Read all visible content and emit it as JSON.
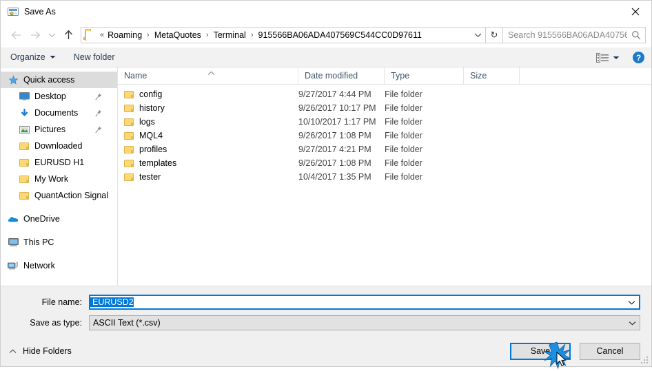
{
  "window": {
    "title": "Save As",
    "icon": "save-as-app-icon",
    "close_label": "✕"
  },
  "nav": {
    "back_icon": "back-arrow-icon",
    "forward_icon": "forward-arrow-icon",
    "recent_icon": "recent-locations-chevron-icon",
    "up_icon": "up-arrow-icon",
    "folder_icon": "folder-icon",
    "overflow": "«",
    "breadcrumbs": [
      "Roaming",
      "MetaQuotes",
      "Terminal",
      "915566BA06ADA407569C544CC0D97611"
    ],
    "separator": "›",
    "dropdown_icon": "chevron-down-icon",
    "refresh_icon": "refresh-icon",
    "refresh_glyph": "↻"
  },
  "search": {
    "placeholder": "Search 915566BA06ADA40756...",
    "icon": "search-icon"
  },
  "toolbar": {
    "organize_label": "Organize",
    "organize_caret": "chevron-down-icon",
    "new_folder_label": "New folder",
    "view_icon": "list-view-icon",
    "view_caret": "chevron-down-icon",
    "help_label": "?",
    "help_icon": "help-icon"
  },
  "sidebar": {
    "items": [
      {
        "label": "Quick access",
        "icon": "star-icon",
        "selected": true,
        "indent": false,
        "pinned": false,
        "group": false
      },
      {
        "label": "Desktop",
        "icon": "desktop-icon",
        "selected": false,
        "indent": true,
        "pinned": true,
        "group": false
      },
      {
        "label": "Documents",
        "icon": "documents-download-icon",
        "selected": false,
        "indent": true,
        "pinned": true,
        "group": false
      },
      {
        "label": "Pictures",
        "icon": "pictures-icon",
        "selected": false,
        "indent": true,
        "pinned": true,
        "group": false
      },
      {
        "label": "Downloaded",
        "icon": "folder-icon",
        "selected": false,
        "indent": true,
        "pinned": false,
        "group": false
      },
      {
        "label": "EURUSD H1",
        "icon": "folder-icon",
        "selected": false,
        "indent": true,
        "pinned": false,
        "group": false
      },
      {
        "label": "My Work",
        "icon": "folder-icon",
        "selected": false,
        "indent": true,
        "pinned": false,
        "group": false
      },
      {
        "label": "QuantAction Signal",
        "icon": "folder-icon",
        "selected": false,
        "indent": true,
        "pinned": false,
        "group": false
      },
      {
        "label": "OneDrive",
        "icon": "onedrive-cloud-icon",
        "selected": false,
        "indent": false,
        "pinned": false,
        "group": true
      },
      {
        "label": "This PC",
        "icon": "this-pc-icon",
        "selected": false,
        "indent": false,
        "pinned": false,
        "group": true
      },
      {
        "label": "Network",
        "icon": "network-icon",
        "selected": false,
        "indent": false,
        "pinned": false,
        "group": true
      }
    ]
  },
  "filelist": {
    "columns": [
      "Name",
      "Date modified",
      "Type",
      "Size"
    ],
    "sort_column": "Name",
    "sort_direction": "ascending",
    "sort_caret": "caret-up-icon",
    "rows": [
      {
        "name": "config",
        "date": "9/27/2017 4:44 PM",
        "type": "File folder",
        "size": ""
      },
      {
        "name": "history",
        "date": "9/26/2017 10:17 PM",
        "type": "File folder",
        "size": ""
      },
      {
        "name": "logs",
        "date": "10/10/2017 1:17 PM",
        "type": "File folder",
        "size": ""
      },
      {
        "name": "MQL4",
        "date": "9/26/2017 1:08 PM",
        "type": "File folder",
        "size": ""
      },
      {
        "name": "profiles",
        "date": "9/27/2017 4:21 PM",
        "type": "File folder",
        "size": ""
      },
      {
        "name": "templates",
        "date": "9/26/2017 1:08 PM",
        "type": "File folder",
        "size": ""
      },
      {
        "name": "tester",
        "date": "10/4/2017 1:35 PM",
        "type": "File folder",
        "size": ""
      }
    ]
  },
  "form": {
    "filename_label": "File name:",
    "filename_value": "EURUSD2",
    "filename_caret": "chevron-down-icon",
    "filetype_label": "Save as type:",
    "filetype_value": "ASCII Text (*.csv)",
    "filetype_caret": "chevron-down-icon"
  },
  "footer": {
    "hide_folders_label": "Hide Folders",
    "hide_folders_caret": "caret-up-icon",
    "save_label": "Save",
    "cancel_label": "Cancel",
    "cursor_icon": "mouse-cursor-icon",
    "click_icon": "click-burst-icon",
    "resize_grip_icon": "resize-grip-icon"
  },
  "colors": {
    "accent": "#0078d7",
    "selection": "#0078d7",
    "folder": "#fcd975",
    "header_text": "#41556e",
    "help_blue": "#1a79c8",
    "sidebar_selected": "#dcdcdc"
  }
}
